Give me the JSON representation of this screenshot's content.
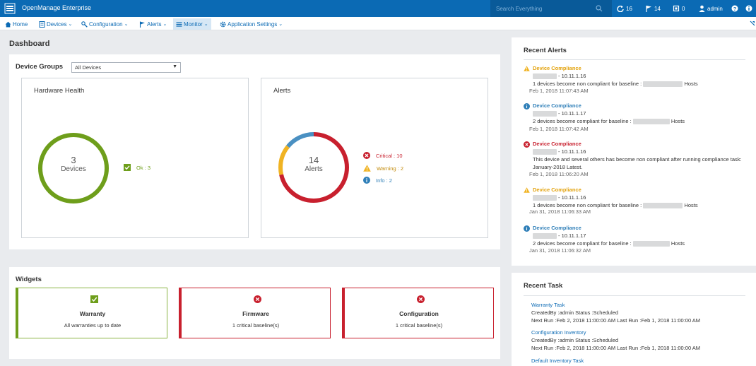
{
  "app": {
    "title": "OpenManage Enterprise"
  },
  "topbar": {
    "search_placeholder": "Search Everything",
    "jobs_count": "16",
    "alerts_count": "14",
    "warranty_count": "0",
    "user": "admin"
  },
  "nav": {
    "home": "Home",
    "devices": "Devices",
    "configuration": "Configuration",
    "alerts": "Alerts",
    "monitor": "Monitor",
    "application_settings": "Application Settings"
  },
  "dashboard": {
    "title": "Dashboard",
    "device_groups_label": "Device Groups",
    "device_groups_value": "All Devices",
    "hardware_health": {
      "title": "Hardware Health",
      "count": "3",
      "count_label": "Devices",
      "legend_ok": "Ok : 3",
      "ok_value": 3
    },
    "alerts": {
      "title": "Alerts",
      "count": "14",
      "count_label": "Alerts",
      "legend": {
        "critical": "Critical : 10",
        "warning": "Warning : 2",
        "info": "Info : 2"
      },
      "values": {
        "critical": 10,
        "warning": 2,
        "info": 2
      },
      "colors": {
        "critical": "#c8202e",
        "warning": "#f0b323",
        "info": "#4a90c2"
      }
    }
  },
  "widgets": {
    "title": "Widgets",
    "items": [
      {
        "title": "Warranty",
        "sub": "All warranties up to date",
        "status": "ok"
      },
      {
        "title": "Firmware",
        "sub": "1 critical baseline(s)",
        "status": "critical"
      },
      {
        "title": "Configuration",
        "sub": "1 critical baseline(s)",
        "status": "critical"
      }
    ]
  },
  "recent_alerts": {
    "title": "Recent Alerts",
    "items": [
      {
        "severity": "warning",
        "title": "Device Compliance",
        "host": "- 10.11.1.16",
        "msg_a": "1 devices become non compliant for baseline :",
        "msg_b": "Hosts",
        "time": "Feb 1, 2018 11:07:43 AM"
      },
      {
        "severity": "info",
        "title": "Device Compliance",
        "host": "- 10.11.1.17",
        "msg_a": "2 devices become compliant for baseline :",
        "msg_b": "Hosts",
        "time": "Feb 1, 2018 11:07:42 AM"
      },
      {
        "severity": "critical",
        "title": "Device Compliance",
        "host": "- 10.11.1.16",
        "msg_a": "This device and several others has become non compliant after running compliance task: January-2018 Latest.",
        "msg_b": "",
        "time": "Feb 1, 2018 11:06:20 AM"
      },
      {
        "severity": "warning",
        "title": "Device Compliance",
        "host": "- 10.11.1.16",
        "msg_a": "1 devices become non compliant for baseline :",
        "msg_b": "Hosts",
        "time": "Jan 31, 2018 11:06:33 AM"
      },
      {
        "severity": "info",
        "title": "Device Compliance",
        "host": "- 10.11.1.17",
        "msg_a": "2 devices become compliant for baseline :",
        "msg_b": "Hosts",
        "time": "Jan 31, 2018 11:06:32 AM"
      }
    ]
  },
  "recent_task": {
    "title": "Recent Task",
    "items": [
      {
        "name": "Warranty Task",
        "line1": "CreatedBy :admin Status :Scheduled",
        "line2": "Next Run :Feb 2, 2018 11:00:00 AM Last Run :Feb 1, 2018 11:00:00 AM"
      },
      {
        "name": "Configuration Inventory",
        "line1": "CreatedBy :admin Status :Scheduled",
        "line2": "Next Run :Feb 2, 2018 11:00:00 AM Last Run :Feb 1, 2018 11:00:00 AM"
      },
      {
        "name": "Default Inventory Task",
        "line1": "",
        "line2": ""
      }
    ]
  },
  "colors": {
    "brand": "#0b6ab4",
    "ok": "#6e9e1b",
    "critical": "#c8202e",
    "warning": "#f0b323",
    "info": "#2f7fb8"
  }
}
